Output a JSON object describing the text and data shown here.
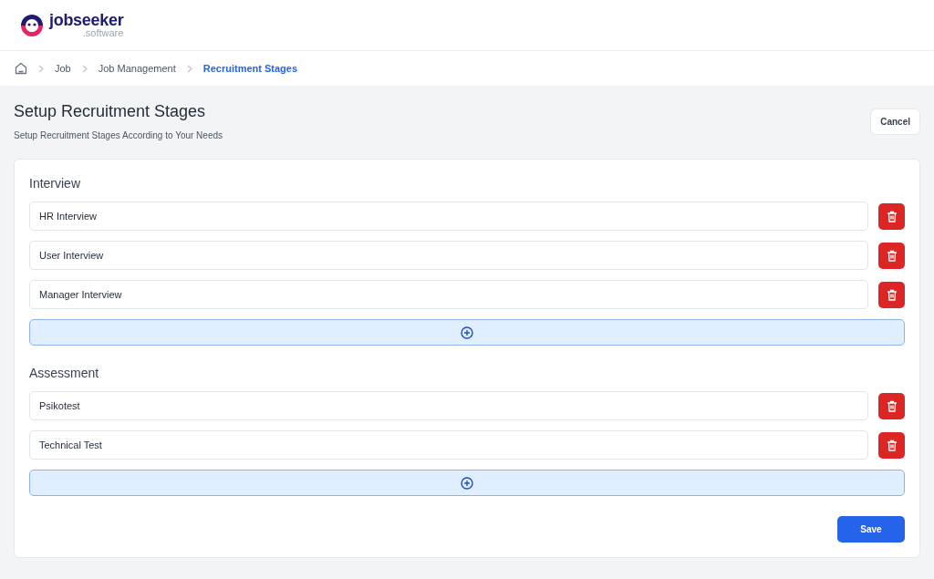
{
  "logo": {
    "name": "jobseeker",
    "suffix": ".software"
  },
  "breadcrumb": [
    {
      "label": "Job",
      "selected": false
    },
    {
      "label": "Job Management",
      "selected": false
    },
    {
      "label": "Recruitment Stages",
      "selected": true
    }
  ],
  "page": {
    "title": "Setup Recruitment Stages",
    "subtitle": "Setup Recruitment Stages According to Your Needs",
    "cancel": "Cancel"
  },
  "sections": [
    {
      "title": "Interview",
      "stages": [
        "HR Interview",
        "User Interview",
        "Manager Interview"
      ]
    },
    {
      "title": "Assessment",
      "stages": [
        "Psikotest",
        "Technical Test"
      ]
    }
  ],
  "save": "Save"
}
